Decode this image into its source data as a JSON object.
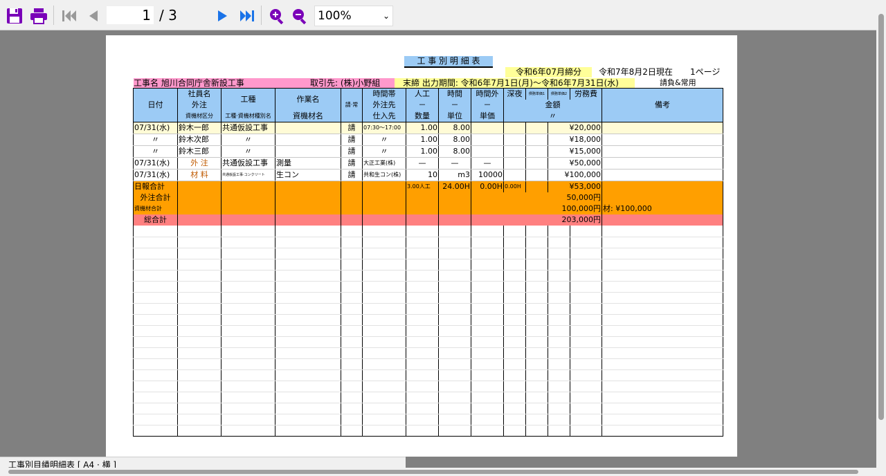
{
  "toolbar": {
    "page_current": "1",
    "page_total": "/ 3",
    "zoom": "100%"
  },
  "sheet_tab": "工事別目績明細表 [ A4 · 横 ]",
  "report": {
    "title": "工 事 別 明 細 表",
    "closing": "令和6年07月締分",
    "as_of": "令和7年8月2日現在",
    "page_label": "1ページ",
    "project": "工事名 旭川合同庁舎新設工事",
    "client": "取引先: (株)小野組",
    "period": "末締  出力期間: 令和6年7月1日(月)〜令和6年7月31日(水)",
    "contract_type": "請負&常用"
  },
  "headers": {
    "date": "日付",
    "emp1": "社員名",
    "emp2": "外注",
    "emp3": "資機材区分",
    "koushu": "工種",
    "koushu_sub": "工種·資機材種別名",
    "work1": "作業名",
    "work2": "資機材名",
    "ukejo": "請·常",
    "time1": "時間帯",
    "time2": "外注先",
    "time3": "仕入先",
    "ninku1": "人工",
    "ninku2": "－",
    "ninku3": "数量",
    "jikan1": "時間",
    "jikan2": "－",
    "jikan3": "単位",
    "jikangai1": "時間外",
    "jikangai2": "－",
    "jikangai3": "単価",
    "shinya": "深夜",
    "sub1": "債務単価1",
    "sub2": "債務単価2",
    "roumu": "労務費",
    "kingaku": "金額",
    "ditto": "〃",
    "bikou": "備考"
  },
  "rows": [
    {
      "date": "07/31(水)",
      "name": "鈴木一郎",
      "koushu": "共通仮設工事",
      "work": "",
      "uk": "請",
      "time": "07:30〜17:00",
      "ninku": "1.00",
      "jikan": "8.00",
      "jikangai": "",
      "shinya": "",
      "amount": "¥20,000",
      "note": ""
    },
    {
      "date": "〃",
      "name": "鈴木次郎",
      "koushu": "〃",
      "work": "",
      "uk": "請",
      "time": "〃",
      "ninku": "1.00",
      "jikan": "8.00",
      "jikangai": "",
      "shinya": "",
      "amount": "¥18,000",
      "note": ""
    },
    {
      "date": "〃",
      "name": "鈴木三郎",
      "koushu": "〃",
      "work": "",
      "uk": "請",
      "time": "〃",
      "ninku": "1.00",
      "jikan": "8.00",
      "jikangai": "",
      "shinya": "",
      "amount": "¥15,000",
      "note": ""
    },
    {
      "date": "07/31(水)",
      "name": "外 注",
      "koushu": "共通仮設工事",
      "work": "測量",
      "uk": "請",
      "time": "大正工業(株)",
      "ninku": "—",
      "jikan": "—",
      "jikangai": "—",
      "shinya": "",
      "amount": "¥50,000",
      "note": ""
    },
    {
      "date": "07/31(水)",
      "name": "材 料",
      "koushu": "共通仮設工事·コンクリート",
      "work": "生コン",
      "uk": "請",
      "time": "共和生コン(株)",
      "ninku": "10",
      "jikan": "m3",
      "jikangai": "10000",
      "shinya": "",
      "amount": "¥100,000",
      "note": ""
    }
  ],
  "totals": {
    "daily_label": "日報合計",
    "daily_ninku": "3.00人工",
    "daily_jikan": "24.00H",
    "daily_jikangai": "0.00H",
    "daily_shinya": "0.00H",
    "daily_amount": "¥53,000",
    "outsource_label": "外注合計",
    "outsource_amount": "50,000円",
    "material_label": "資機材合計",
    "material_amount": "100,000円",
    "material_note": "材: ¥100,000",
    "grand_label": "総合計",
    "grand_amount": "203,000円"
  },
  "colors": {
    "header_blue": "#9ccbf5",
    "highlight_yellow": "#ffff99",
    "pink": "#ff99cc",
    "orange": "#ff9f00",
    "total_red": "#ff8080",
    "accent_purple": "#7a00b8",
    "nav_blue": "#1a73e8"
  }
}
